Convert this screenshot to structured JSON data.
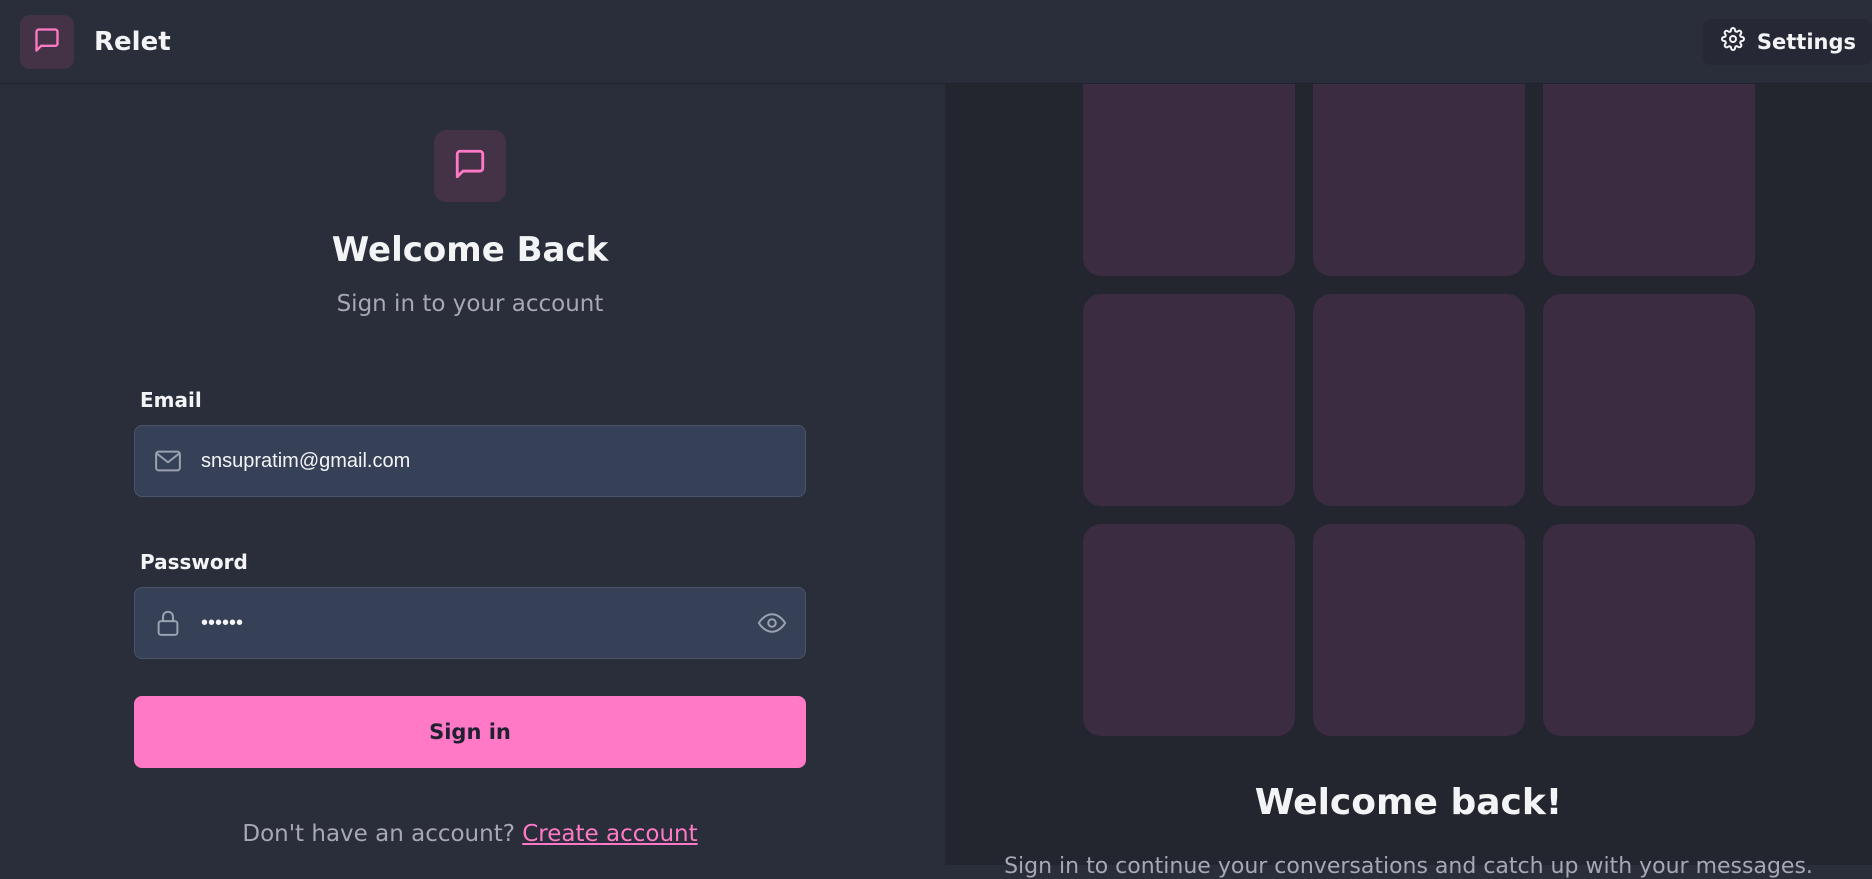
{
  "header": {
    "brand_name": "Relet",
    "settings_label": "Settings",
    "icons": {
      "brand": "chat-bubble-icon",
      "settings": "gear-icon"
    }
  },
  "login": {
    "title": "Welcome Back",
    "subtitle": "Sign in to your account",
    "email_label": "Email",
    "email_value": "snsupratim@gmail.com",
    "password_label": "Password",
    "password_value": "••••••",
    "signin_label": "Sign in",
    "no_account_text": "Don't have an account?",
    "create_account_link": "Create account",
    "icons": {
      "hero": "chat-bubble-icon",
      "email": "mail-icon",
      "password": "lock-icon",
      "reveal": "eye-icon"
    }
  },
  "promo": {
    "title": "Welcome back!",
    "description": "Sign in to continue your conversations and catch up with your messages."
  },
  "colors": {
    "accent": "#ff79c6",
    "background": "#2a2d3a",
    "panel": "#23252f",
    "input": "#364056",
    "tile": "#3c2c42"
  }
}
